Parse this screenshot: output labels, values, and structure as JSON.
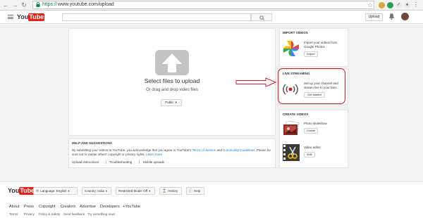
{
  "browser": {
    "url_scheme": "https://",
    "url_rest": "www.youtube.com/upload"
  },
  "header": {
    "logo_you": "You",
    "logo_tube": "Tube",
    "logo_sup": "IN",
    "search_placeholder": "",
    "upload_label": "Upload"
  },
  "upload": {
    "select_label": "Select files to upload",
    "drag_label": "Or drag and drop video files",
    "privacy_value": "Public"
  },
  "help": {
    "title": "HELP AND SUGGESTIONS",
    "text_part1": "By submitting your videos to YouTube, you acknowledge that you agree to YouTube's ",
    "tos_link": "Terms of Service",
    "text_and": " and ",
    "guidelines_link": "Community Guidelines",
    "text_part2": ". Please be sure not to violate others' copyright or privacy rights. ",
    "learn_more": "Learn more",
    "links": [
      "Upload instructions",
      "Troubleshooting",
      "Mobile uploads"
    ]
  },
  "import_videos": {
    "title": "IMPORT VIDEOS",
    "text": "Import your videos from Google Photos",
    "button": "Import"
  },
  "live_streaming": {
    "title": "LIVE STREAMING",
    "text": "Set up your channel and stream live to your fans.",
    "button": "Get started"
  },
  "create_videos": {
    "title": "CREATE VIDEOS",
    "slideshow_label": "Photo slideshow",
    "slideshow_button": "Create",
    "editor_label": "Video editor",
    "editor_button": "Edit"
  },
  "footer": {
    "language": "Language: English",
    "country": "Country: India",
    "restricted": "Restricted Mode: Off",
    "history": "History",
    "help": "Help",
    "links": [
      "About",
      "Press",
      "Copyright",
      "Creators",
      "Advertise",
      "Developers",
      "+YouTube"
    ],
    "sub_links": [
      "Terms",
      "Privacy",
      "Policy & Safety",
      "Send feedback",
      "Try something new!"
    ]
  },
  "icons": {
    "back": "back-arrow-icon",
    "forward": "forward-arrow-icon",
    "reload": "reload-icon",
    "lock": "lock-icon",
    "bell": "bell-icon",
    "upload_arrow": "upload-arrow-icon",
    "photos": "google-photos-icon",
    "live": "live-broadcast-icon"
  },
  "colors": {
    "brand_red": "#e62117",
    "link_blue": "#167ac6",
    "annotation_red": "#c8202a"
  }
}
